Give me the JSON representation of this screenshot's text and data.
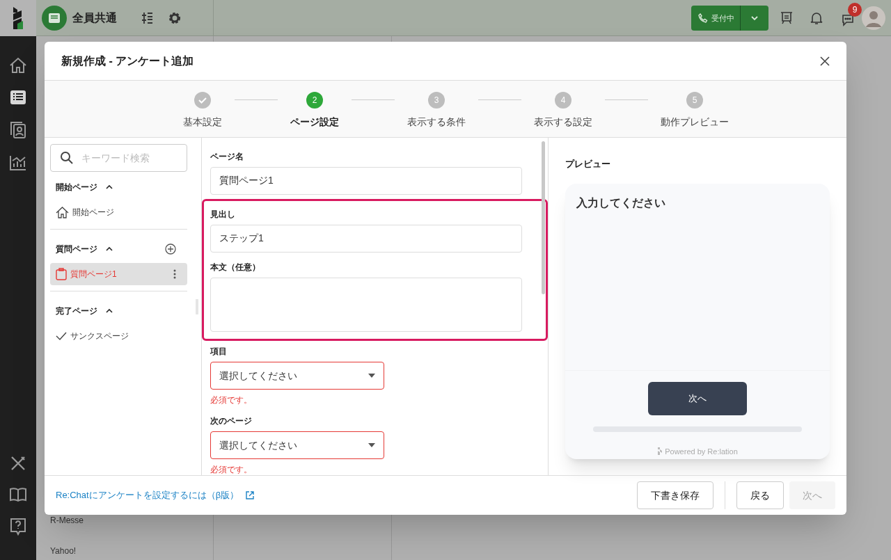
{
  "app": {
    "workspace": "全員共通",
    "status_button": "受付中",
    "chat_badge": "9",
    "background_list": [
      "R-Messe",
      "Yahoo!"
    ]
  },
  "modal": {
    "title": "新規作成 - アンケート追加"
  },
  "steps": [
    {
      "label": "基本設定",
      "kind": "done"
    },
    {
      "label": "ページ設定",
      "number": "2",
      "kind": "current"
    },
    {
      "label": "表示する条件",
      "number": "3",
      "kind": "upcoming"
    },
    {
      "label": "表示する設定",
      "number": "4",
      "kind": "upcoming"
    },
    {
      "label": "動作プレビュー",
      "number": "5",
      "kind": "upcoming"
    }
  ],
  "nav": {
    "search_placeholder": "キーワード検索",
    "sections": [
      {
        "title": "開始ページ",
        "expanded": true,
        "can_add": false,
        "items": [
          {
            "label": "開始ページ",
            "kind": "home",
            "selected": false
          }
        ]
      },
      {
        "title": "質問ページ",
        "expanded": true,
        "can_add": true,
        "items": [
          {
            "label": "質問ページ1",
            "kind": "question",
            "selected": true
          }
        ]
      },
      {
        "title": "完了ページ",
        "expanded": true,
        "can_add": false,
        "items": [
          {
            "label": "サンクスページ",
            "kind": "thanks",
            "selected": false
          }
        ]
      }
    ]
  },
  "form": {
    "sections": [
      {
        "highlighted": false,
        "fields": [
          {
            "kind": "text",
            "label": "ページ名",
            "value": "質問ページ1"
          }
        ]
      },
      {
        "highlighted": true,
        "fields": [
          {
            "kind": "text",
            "label": "見出し",
            "value": "ステップ1"
          },
          {
            "kind": "textarea",
            "label": "本文（任意）"
          }
        ]
      },
      {
        "highlighted": false,
        "fields": [
          {
            "kind": "select",
            "label": "項目",
            "prompt": "選択してください",
            "error": "必須です。"
          },
          {
            "kind": "select",
            "label": "次のページ",
            "prompt": "選択してください",
            "error": "必須です。"
          }
        ]
      }
    ]
  },
  "preview": {
    "title": "プレビュー",
    "heading": "入力してください",
    "button": "次へ",
    "progress": {
      "level": 0
    },
    "powered_by": "Powered by Re:lation"
  },
  "footer": {
    "help_link": "Re:Chatにアンケートを設定するには（β版）",
    "draft_buttons": [
      {
        "label": "下書き保存",
        "disabled": false
      }
    ],
    "nav_buttons": [
      {
        "label": "戻る",
        "disabled": false
      },
      {
        "label": "次へ",
        "disabled": true
      }
    ]
  }
}
